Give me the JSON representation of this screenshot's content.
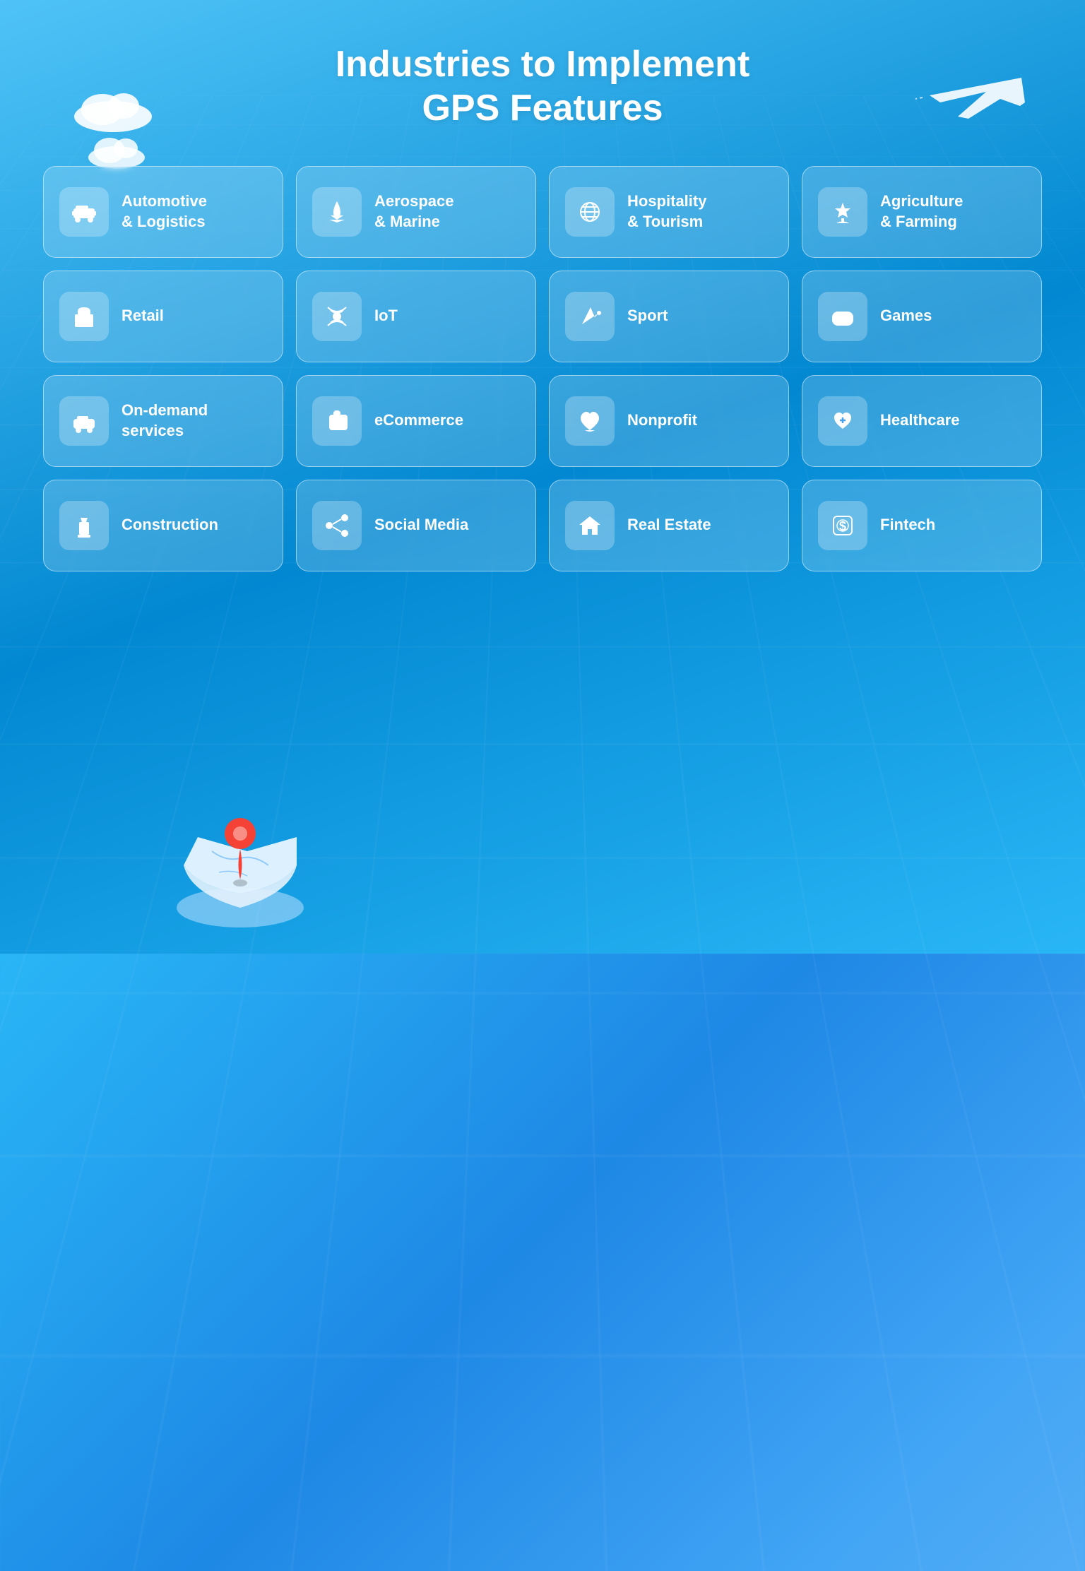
{
  "page": {
    "title_line1": "Industries to Implement",
    "title_line2": "GPS Features",
    "background_color_start": "#29b6f6",
    "background_color_end": "#1e88e5"
  },
  "industries": [
    {
      "id": "automotive-logistics",
      "label": "Automotive\n& Logistics",
      "icon": "🚗"
    },
    {
      "id": "aerospace-marine",
      "label": "Aerospace\n& Marine",
      "icon": "🚀"
    },
    {
      "id": "hospitality-tourism",
      "label": "Hospitality\n& Tourism",
      "icon": "🌐"
    },
    {
      "id": "agriculture-farming",
      "label": "Agriculture\n& Farming",
      "icon": "🌾"
    },
    {
      "id": "retail",
      "label": "Retail",
      "icon": "🏪"
    },
    {
      "id": "iot",
      "label": "IoT",
      "icon": "📡"
    },
    {
      "id": "sport",
      "label": "Sport",
      "icon": "✏️"
    },
    {
      "id": "games",
      "label": "Games",
      "icon": "🎮"
    },
    {
      "id": "on-demand",
      "label": "On-demand\nservices",
      "icon": "🚕"
    },
    {
      "id": "ecommerce",
      "label": "eCommerce",
      "icon": "🛒"
    },
    {
      "id": "nonprofit",
      "label": "Nonprofit",
      "icon": "🤲"
    },
    {
      "id": "healthcare",
      "label": "Healthcare",
      "icon": "💊"
    },
    {
      "id": "construction",
      "label": "Construction",
      "icon": "👷"
    },
    {
      "id": "social-media",
      "label": "Social Media",
      "icon": "📲"
    },
    {
      "id": "real-estate",
      "label": "Real Estate",
      "icon": "🏠"
    },
    {
      "id": "fintech",
      "label": "Fintech",
      "icon": "💲"
    }
  ]
}
